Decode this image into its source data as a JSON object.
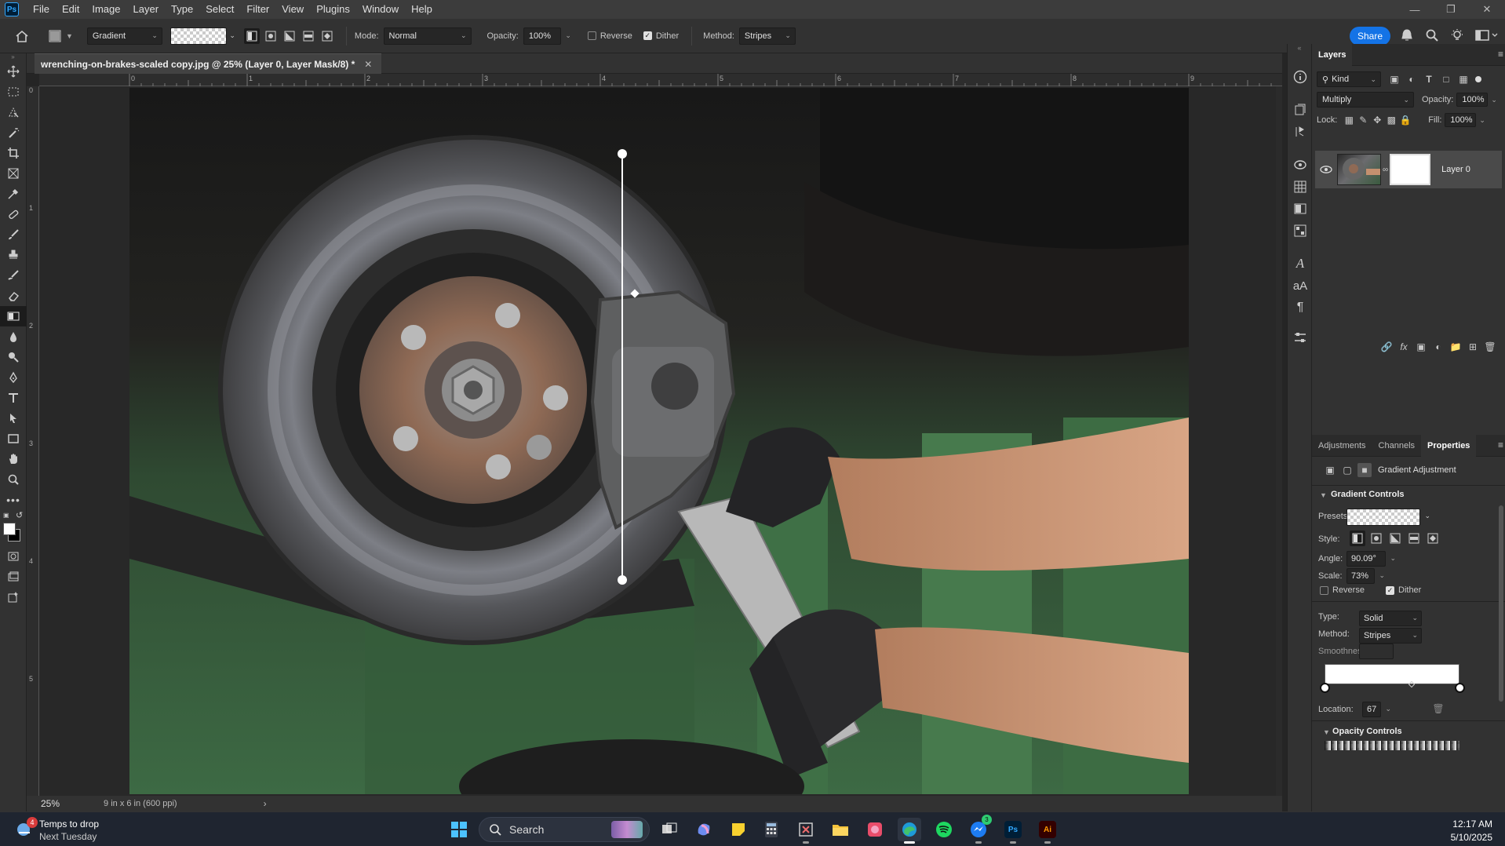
{
  "menubar": {
    "logo": "Ps",
    "items": [
      "File",
      "Edit",
      "Image",
      "Layer",
      "Type",
      "Select",
      "Filter",
      "View",
      "Plugins",
      "Window",
      "Help"
    ]
  },
  "options": {
    "tool_preset": "Gradient",
    "mode_label": "Mode:",
    "mode_value": "Normal",
    "opacity_label": "Opacity:",
    "opacity_value": "100%",
    "reverse_label": "Reverse",
    "dither_label": "Dither",
    "method_label": "Method:",
    "method_value": "Stripes",
    "share_label": "Share"
  },
  "document": {
    "tab_title": "wrenching-on-brakes-scaled copy.jpg @ 25% (Layer 0, Layer Mask/8) *",
    "zoom": "25%",
    "doc_info": "9 in x 6 in (600 ppi)",
    "ruler_h": [
      "0",
      "1",
      "2",
      "3",
      "4",
      "5",
      "6",
      "7",
      "8",
      "9"
    ],
    "ruler_v": [
      "0",
      "1",
      "2",
      "3",
      "4",
      "5"
    ]
  },
  "layers_panel": {
    "title": "Layers",
    "filter_kind": "Kind",
    "blend_mode": "Multiply",
    "opacity_label": "Opacity:",
    "opacity_value": "100%",
    "lock_label": "Lock:",
    "fill_label": "Fill:",
    "fill_value": "100%",
    "layer_name": "Layer 0"
  },
  "properties_panel": {
    "tabs": [
      "Adjustments",
      "Channels",
      "Properties"
    ],
    "active_tab": "Properties",
    "adjustment_type": "Gradient Adjustment",
    "section_gradient": "Gradient Controls",
    "presets_label": "Presets:",
    "style_label": "Style:",
    "angle_label": "Angle:",
    "angle_value": "90.09°",
    "scale_label": "Scale:",
    "scale_value": "73%",
    "reverse_label": "Reverse",
    "dither_label": "Dither",
    "type_label": "Type:",
    "type_value": "Solid",
    "method_label": "Method:",
    "method_value": "Stripes",
    "smoothness_label": "Smoothness:",
    "location_label": "Location:",
    "location_value": "67",
    "section_opacity": "Opacity Controls"
  },
  "taskbar": {
    "weather_title": "Temps to drop",
    "weather_sub": "Next Tuesday",
    "weather_badge": "4",
    "search_placeholder": "Search",
    "messenger_badge": "3",
    "time": "12:17 AM",
    "date": "5/10/2025"
  },
  "colors": {
    "accent": "#1473e6",
    "panel_bg": "#323232",
    "canvas_bg": "#282828",
    "taskbar_bg": "#1f2530"
  }
}
